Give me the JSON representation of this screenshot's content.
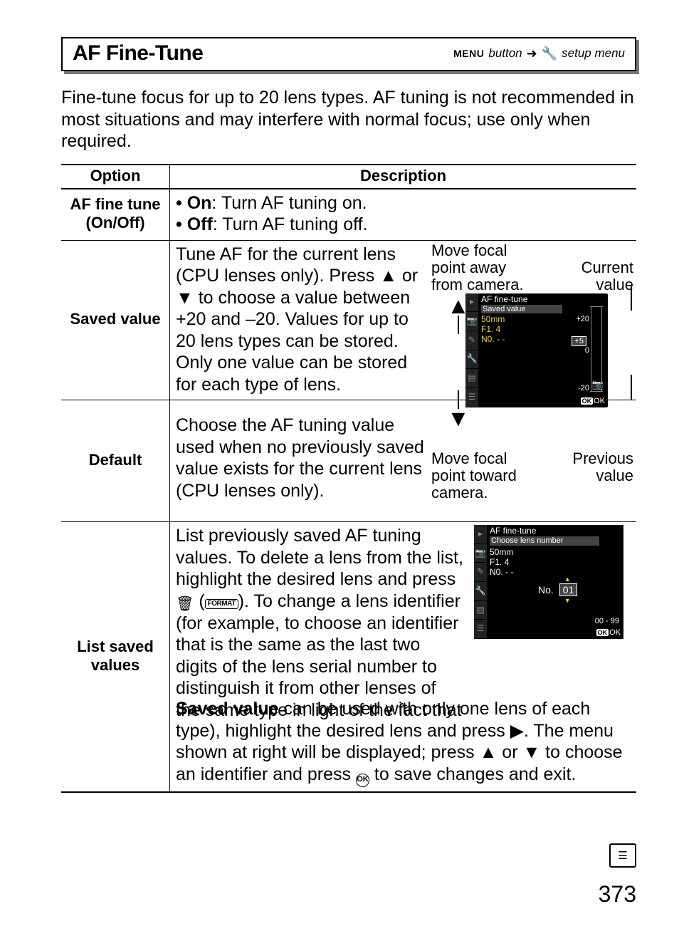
{
  "titlebar": {
    "title": "AF Fine-Tune",
    "menu_label": "MENU",
    "button_word": "button",
    "arrow": "➜",
    "setup_menu": "setup menu"
  },
  "intro": "Fine-tune focus for up to 20 lens types.  AF tuning is not recommended in most situations and may interfere with normal focus; use only when required.",
  "table": {
    "head_option": "Option",
    "head_desc": "Description",
    "rows": {
      "af_on_off": {
        "name": "AF fine tune (On/Off)",
        "on_label": "On",
        "on_text": ": Turn AF tuning on.",
        "off_label": "Off",
        "off_text": ": Turn AF tuning off."
      },
      "saved_value": {
        "name": "Saved value",
        "text": "Tune AF for the current lens (CPU lenses only).  Press ▲ or ▼ to choose a value between +20 and –20. Values for up to 20 lens types can be stored.  Only one value can be stored for each type of lens."
      },
      "default": {
        "name": "Default",
        "text": "Choose the AF tuning value used when no previously saved value exists for the current lens (CPU lenses only)."
      },
      "list_saved": {
        "name": "List saved values",
        "text1": "List previously saved AF tuning values.  To delete a lens from the list, highlight the desired lens and press ",
        "trash": "🗑",
        "format": "FORMAT",
        "text2": ". To change a lens identifier (for example, to choose an identifier that is the same as the last two digits of the lens serial number to distinguish it from other lenses of the same type in light of the fact that ",
        "saved_bold": "Saved value",
        "text3": " can be used with only one lens of each type), highlight the desired lens and press ▶.  The menu shown at right will be displayed; press ▲ or ▼ to choose an identifier and press ",
        "ok": "OK",
        "text4": " to save changes and exit."
      }
    }
  },
  "diagram": {
    "move_away": "Move focal point away from camera.",
    "move_toward": "Move focal point toward camera.",
    "current_value": "Current value",
    "previous_value": "Previous value",
    "lcd": {
      "title": "AF fine-tune",
      "sub": "Saved value",
      "lens_mm": "50mm",
      "lens_f": "F1. 4",
      "lens_no": "N0. - -",
      "plus20": "+20",
      "minus20": "-20",
      "zero": "0",
      "valbox": "+5",
      "ok": "OK"
    }
  },
  "diagram2": {
    "title": "AF fine-tune",
    "sub": "Choose lens number",
    "lens_mm": "50mm",
    "lens_f": "F1. 4",
    "lens_no": "N0. - -",
    "no_label": "No.",
    "no_val": "01",
    "range": "00 - 99",
    "ok": "OK"
  },
  "footer": {
    "page": "373"
  }
}
